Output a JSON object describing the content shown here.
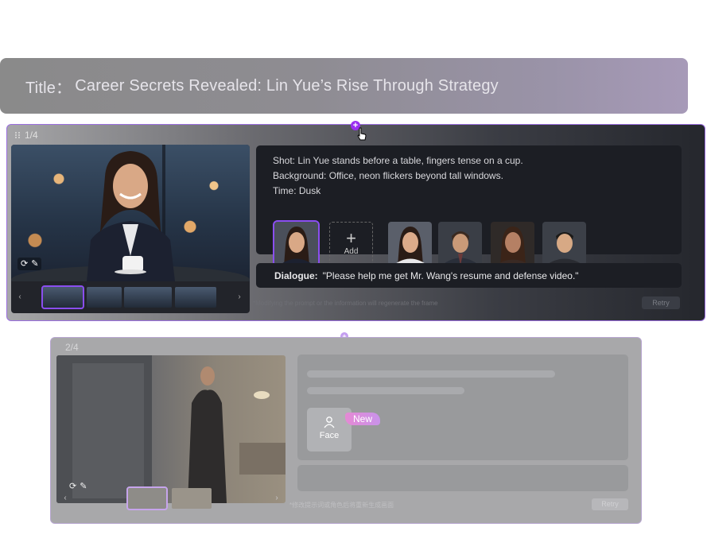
{
  "header": {
    "title_label": "Title：",
    "title_text": "Career Secrets Revealed: Lin Yue’s Rise Through Strategy"
  },
  "shot1": {
    "counter": "1/4",
    "prompt": {
      "shot": "Shot: Lin Yue stands before a table, fingers tense on a cup.",
      "background": "Background: Office, neon flickers beyond tall windows.",
      "time": "Time: Dusk"
    },
    "add_label": "Add",
    "dialogue_key": "Dialogue:",
    "dialogue_text": "\"Please help me get Mr. Wang's resume and defense video.\"",
    "note": "*Modifying the prompt or the information will regenerate the frame",
    "retry_label": "Retry",
    "accent_color": "#9b6fe0"
  },
  "shot2": {
    "counter": "2/4",
    "face_label": "Face",
    "new_badge": "New",
    "note": "*修改提示词或角色后将重新生成画面",
    "retry_label": "Retry"
  }
}
